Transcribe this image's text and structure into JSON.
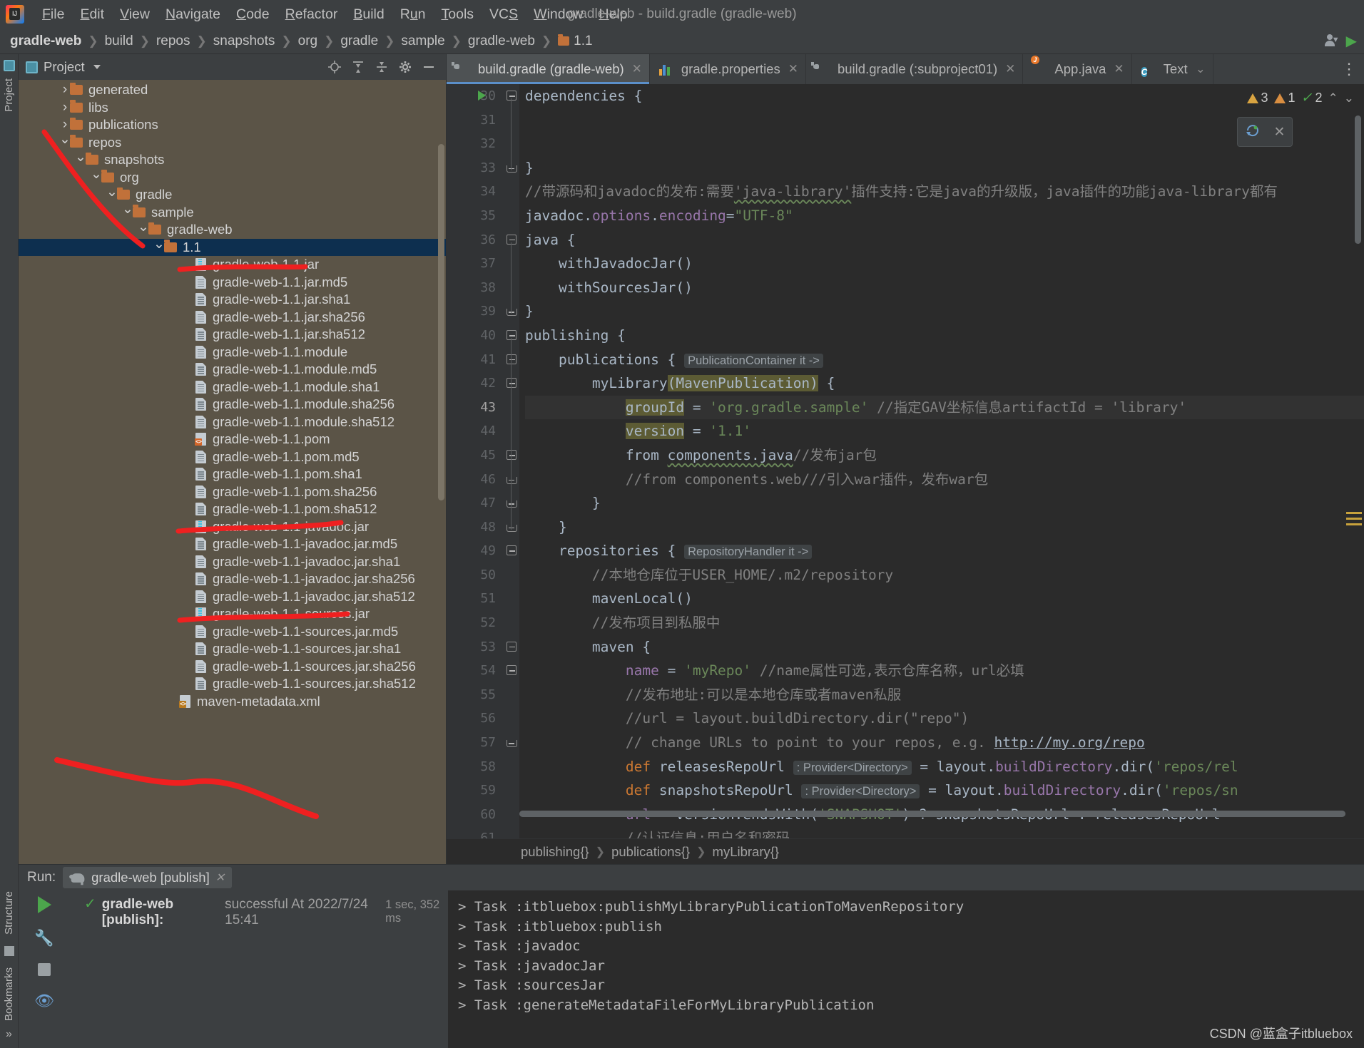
{
  "window": {
    "title": "gradle-web - build.gradle (gradle-web)"
  },
  "menubar": {
    "items": [
      "File",
      "Edit",
      "View",
      "Navigate",
      "Code",
      "Refactor",
      "Build",
      "Run",
      "Tools",
      "VCS",
      "Window",
      "Help"
    ]
  },
  "breadcrumb": {
    "items": [
      "gradle-web",
      "build",
      "repos",
      "snapshots",
      "org",
      "gradle",
      "sample",
      "gradle-web",
      "1.1"
    ]
  },
  "project_panel": {
    "title": "Project",
    "tree": [
      {
        "label": "generated",
        "type": "folder",
        "indent": 2,
        "arrow": "right"
      },
      {
        "label": "libs",
        "type": "folder",
        "indent": 2,
        "arrow": "right"
      },
      {
        "label": "publications",
        "type": "folder",
        "indent": 2,
        "arrow": "right"
      },
      {
        "label": "repos",
        "type": "folder",
        "indent": 2,
        "arrow": "down"
      },
      {
        "label": "snapshots",
        "type": "folder",
        "indent": 3,
        "arrow": "down"
      },
      {
        "label": "org",
        "type": "folder",
        "indent": 4,
        "arrow": "down"
      },
      {
        "label": "gradle",
        "type": "folder",
        "indent": 5,
        "arrow": "down"
      },
      {
        "label": "sample",
        "type": "folder",
        "indent": 6,
        "arrow": "down"
      },
      {
        "label": "gradle-web",
        "type": "folder",
        "indent": 7,
        "arrow": "down"
      },
      {
        "label": "1.1",
        "type": "folder",
        "indent": 8,
        "arrow": "down",
        "selected": true
      },
      {
        "label": "gradle-web-1.1.jar",
        "type": "jar",
        "indent": 10
      },
      {
        "label": "gradle-web-1.1.jar.md5",
        "type": "file",
        "indent": 10
      },
      {
        "label": "gradle-web-1.1.jar.sha1",
        "type": "file",
        "indent": 10
      },
      {
        "label": "gradle-web-1.1.jar.sha256",
        "type": "file",
        "indent": 10
      },
      {
        "label": "gradle-web-1.1.jar.sha512",
        "type": "file",
        "indent": 10
      },
      {
        "label": "gradle-web-1.1.module",
        "type": "file",
        "indent": 10
      },
      {
        "label": "gradle-web-1.1.module.md5",
        "type": "file",
        "indent": 10
      },
      {
        "label": "gradle-web-1.1.module.sha1",
        "type": "file",
        "indent": 10
      },
      {
        "label": "gradle-web-1.1.module.sha256",
        "type": "file",
        "indent": 10
      },
      {
        "label": "gradle-web-1.1.module.sha512",
        "type": "file",
        "indent": 10
      },
      {
        "label": "gradle-web-1.1.pom",
        "type": "pom",
        "indent": 10
      },
      {
        "label": "gradle-web-1.1.pom.md5",
        "type": "file",
        "indent": 10
      },
      {
        "label": "gradle-web-1.1.pom.sha1",
        "type": "file",
        "indent": 10
      },
      {
        "label": "gradle-web-1.1.pom.sha256",
        "type": "file",
        "indent": 10
      },
      {
        "label": "gradle-web-1.1.pom.sha512",
        "type": "file",
        "indent": 10
      },
      {
        "label": "gradle-web-1.1-javadoc.jar",
        "type": "jar",
        "indent": 10
      },
      {
        "label": "gradle-web-1.1-javadoc.jar.md5",
        "type": "file",
        "indent": 10
      },
      {
        "label": "gradle-web-1.1-javadoc.jar.sha1",
        "type": "file",
        "indent": 10
      },
      {
        "label": "gradle-web-1.1-javadoc.jar.sha256",
        "type": "file",
        "indent": 10
      },
      {
        "label": "gradle-web-1.1-javadoc.jar.sha512",
        "type": "file",
        "indent": 10
      },
      {
        "label": "gradle-web-1.1-sources.jar",
        "type": "jar",
        "indent": 10
      },
      {
        "label": "gradle-web-1.1-sources.jar.md5",
        "type": "file",
        "indent": 10
      },
      {
        "label": "gradle-web-1.1-sources.jar.sha1",
        "type": "file",
        "indent": 10
      },
      {
        "label": "gradle-web-1.1-sources.jar.sha256",
        "type": "file",
        "indent": 10
      },
      {
        "label": "gradle-web-1.1-sources.jar.sha512",
        "type": "file",
        "indent": 10
      },
      {
        "label": "maven-metadata.xml",
        "type": "xml",
        "indent": 9
      }
    ]
  },
  "editor": {
    "tabs": [
      {
        "label": "build.gradle (gradle-web)",
        "icon": "gradle-icon",
        "active": true,
        "closable": true
      },
      {
        "label": "gradle.properties",
        "icon": "properties-icon",
        "active": false,
        "closable": true
      },
      {
        "label": "build.gradle (:subproject01)",
        "icon": "gradle-icon",
        "active": false,
        "closable": true
      },
      {
        "label": "App.java",
        "icon": "java-class-icon",
        "active": false,
        "closable": true
      },
      {
        "label": "Text",
        "icon": "class-icon",
        "active": false,
        "closable": false
      }
    ],
    "status": {
      "warnings_yellow": "3",
      "warnings_orange": "1",
      "checks_ok": "2"
    },
    "first_line_number": 30,
    "current_line": 43,
    "lines": [
      {
        "n": 30,
        "runnable": true,
        "fold": "open",
        "html": "<span class=\"k\">dependencies</span> {"
      },
      {
        "n": 31,
        "html": ""
      },
      {
        "n": 32,
        "html": ""
      },
      {
        "n": 33,
        "fold": "end",
        "html": "}"
      },
      {
        "n": 34,
        "html": "<span class=\"cmt\">//带源码和javadoc的发布:需要</span><span class=\"cmt wavy\">'java-library'</span><span class=\"cmt\">插件支持:它是java的升级版，java插件的功能java-library都有</span>"
      },
      {
        "n": 35,
        "html": "<span class=\"k\">javadoc</span><span class=\"k\">.</span><span class=\"fld\">options</span><span class=\"k\">.</span><span class=\"fld\">encoding</span>=<span class=\"str\">\"UTF-8\"</span>"
      },
      {
        "n": 36,
        "fold": "open",
        "html": "<span class=\"k\">java</span> {"
      },
      {
        "n": 37,
        "html": "    <span class=\"k\">withJavadocJar</span>()"
      },
      {
        "n": 38,
        "html": "    <span class=\"k\">withSourcesJar</span>()"
      },
      {
        "n": 39,
        "fold": "end",
        "html": "}"
      },
      {
        "n": 40,
        "fold": "open",
        "html": "<span class=\"k\">publishing</span> {"
      },
      {
        "n": 41,
        "fold": "open2",
        "html": "    <span class=\"k\">publications</span> { <span class=\"typehint\">PublicationContainer it -&gt;</span>"
      },
      {
        "n": 42,
        "fold": "open2",
        "html": "        <span class=\"k\">myLibrary</span><span class=\"hlbox\">(MavenPublication)</span> {"
      },
      {
        "n": 43,
        "current": true,
        "html": "            <span class=\"hlbox\">groupId</span> = <span class=\"str\">'org.gradle.sample'</span> <span class=\"cmt\">//指定GAV坐标信息artifactId = 'library'</span>"
      },
      {
        "n": 44,
        "html": "            <span class=\"hlbox\">version</span> = <span class=\"str\">'1.1'</span>"
      },
      {
        "n": 45,
        "fold": "open2",
        "html": "            <span class=\"k\">from</span> <span class=\"k wavy\">components.java</span><span class=\"cmt\">//发布jar包</span>"
      },
      {
        "n": 46,
        "fold": "end2",
        "html": "            <span class=\"cmt\">//from components.web///引入war插件，发布war包</span>"
      },
      {
        "n": 47,
        "fold": "end2",
        "html": "        }"
      },
      {
        "n": 48,
        "fold": "end2",
        "html": "    }"
      },
      {
        "n": 49,
        "fold": "open2",
        "html": "    <span class=\"k\">repositories</span> { <span class=\"typehint\">RepositoryHandler it -&gt;</span>"
      },
      {
        "n": 50,
        "html": "        <span class=\"cmt\">//本地仓库位于USER_HOME/.m2/repository</span>"
      },
      {
        "n": 51,
        "html": "        <span class=\"k\">mavenLocal</span>()"
      },
      {
        "n": 52,
        "html": "        <span class=\"cmt\">//发布项目到私服中</span>"
      },
      {
        "n": 53,
        "fold": "open2",
        "html": "        <span class=\"k\">maven</span> {"
      },
      {
        "n": 54,
        "fold": "open2",
        "html": "            <span class=\"fld\">name</span> = <span class=\"str\">'myRepo'</span> <span class=\"cmt\">//name属性可选,表示仓库名称，url必填</span>"
      },
      {
        "n": 55,
        "html": "            <span class=\"cmt\">//发布地址:可以是本地仓库或者maven私服</span>"
      },
      {
        "n": 56,
        "html": "            <span class=\"cmt\">//url = layout.buildDirectory.dir(\"repo\")</span>"
      },
      {
        "n": 57,
        "fold": "end2",
        "html": "            <span class=\"cmt\">// change URLs to point to your repos, e.g. </span><span class=\"cmt link\">http://my.org/repo</span>"
      },
      {
        "n": 58,
        "html": "            <span class=\"kw\">def</span> <span class=\"k\">releasesRepoUrl</span> <span class=\"typehint\">: Provider&lt;Directory&gt;</span> = <span class=\"k\">layout</span>.<span class=\"fld\">buildDirectory</span>.<span class=\"k\">dir</span>(<span class=\"str\">'repos/rel</span>"
      },
      {
        "n": 59,
        "html": "            <span class=\"kw\">def</span> <span class=\"k\">snapshotsRepoUrl</span> <span class=\"typehint\">: Provider&lt;Directory&gt;</span> = <span class=\"k\">layout</span>.<span class=\"fld\">buildDirectory</span>.<span class=\"k\">dir</span>(<span class=\"str\">'repos/sn</span>"
      },
      {
        "n": 60,
        "html": "            <span class=\"fld\">url</span> = <span class=\"k\">version</span>.<span class=\"k\">endsWith</span>(<span class=\"str\">'SNAPSHOT'</span>) ? <span class=\"k\">snapshotsRepoUrl</span> : <span class=\"k\">releasesRepoUrl</span>"
      },
      {
        "n": 61,
        "html": "            <span class=\"cmt\">//认证信息:用户名和密码</span>"
      }
    ],
    "bottom_breadcrumb": [
      "publishing{}",
      "publications{}",
      "myLibrary{}"
    ]
  },
  "run_panel": {
    "label": "Run:",
    "tab_label": "gradle-web [publish]",
    "status_name": "gradle-web [publish]:",
    "status_result": "successful At 2022/7/24 15:41",
    "status_duration": "1 sec, 352 ms",
    "output": [
      "> Task :itbluebox:publishMyLibraryPublicationToMavenRepository",
      "> Task :itbluebox:publish",
      "> Task :javadoc",
      "> Task :javadocJar",
      "> Task :sourcesJar",
      "> Task :generateMetadataFileForMyLibraryPublication"
    ],
    "watermark": "CSDN @蓝盒子itbluebox"
  },
  "rails": {
    "left_top": "Project",
    "left_structure": "Structure",
    "left_bookmarks": "Bookmarks"
  },
  "colors": {
    "accent_blue": "#5b8fc9",
    "folder_orange": "#c1713a",
    "selection": "#0d2f4f",
    "panel_bg": "#5b5447",
    "editor_bg": "#2b2b2b",
    "annotation_red": "#ef2020"
  }
}
